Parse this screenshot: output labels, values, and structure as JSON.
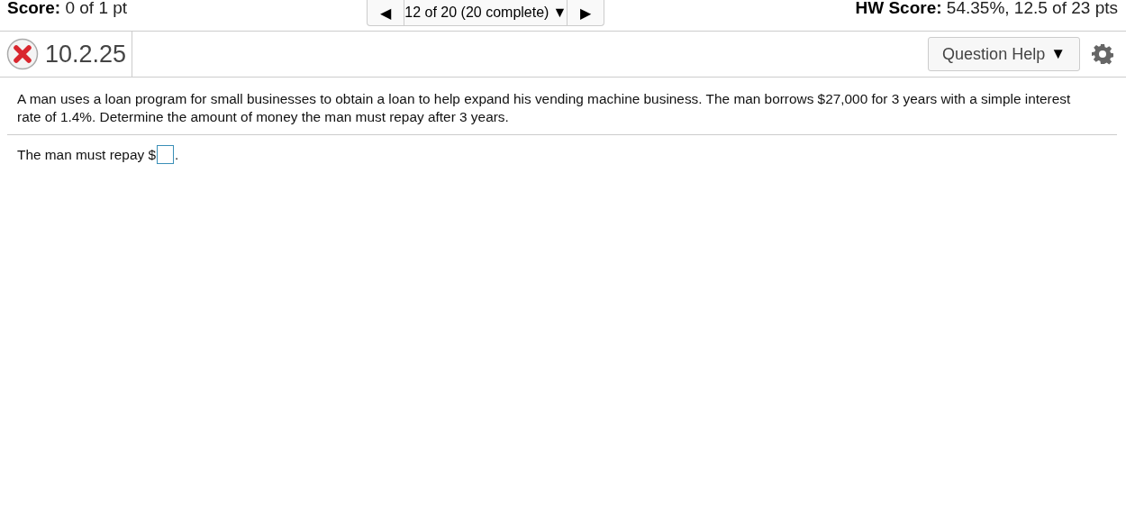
{
  "header": {
    "score": "**Score:** 0 of 1 pt",
    "navigator": {
      "previous": "◀",
      "position": "12 of 20 (20 complete)",
      "dropdown": "▼",
      "next": "▶"
    },
    "hw_score": "**HW Score:** 54.35%, 12.5 of 23 pts"
  },
  "question_bar": {
    "correct": false,
    "number": "10.2.25",
    "help_button": "Question Help",
    "help_caret": "▼"
  },
  "question": {
    "text": "A man uses a loan program for small businesses to obtain a loan to help expand his vending machine business. The man borrows $27,000 for 3 years with a simple interest rate of 1.4%. Determine the amount of money the man must repay after 3 years.",
    "answer": {
      "prefix": "The man must repay $",
      "suffix": "."
    }
  }
}
